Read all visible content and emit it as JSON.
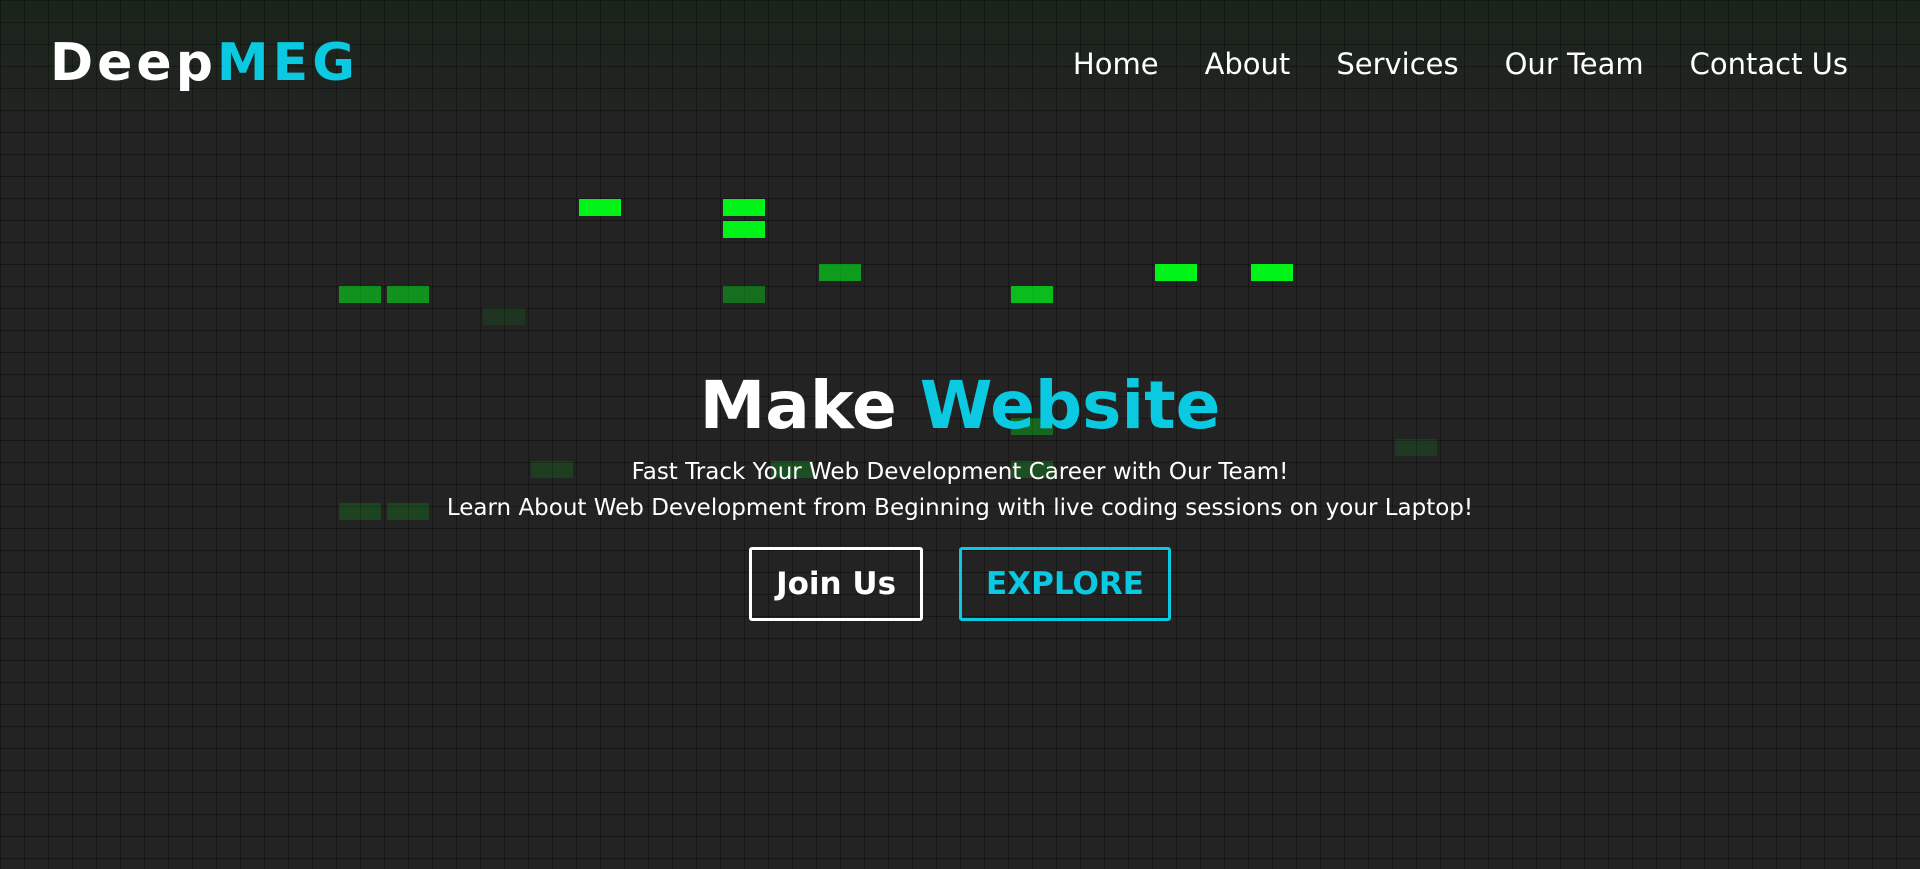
{
  "logo": {
    "main": "Deep",
    "accent": "MEG"
  },
  "nav": {
    "home": "Home",
    "about": "About",
    "services": "Services",
    "team": "Our Team",
    "contact": "Contact Us"
  },
  "hero": {
    "title_main": "Make",
    "title_accent": "Website",
    "subtitle_1": "Fast Track Your Web Development Career with Our Team!",
    "subtitle_2": "Learn About Web Development from Beginning with live coding sessions on your Laptop!"
  },
  "buttons": {
    "join": "Join Us",
    "explore": "EXPLORE"
  },
  "colors": {
    "background": "#232323",
    "accent": "#0ac9e0",
    "tile_green": "#00ff1a",
    "text": "#ffffff"
  }
}
